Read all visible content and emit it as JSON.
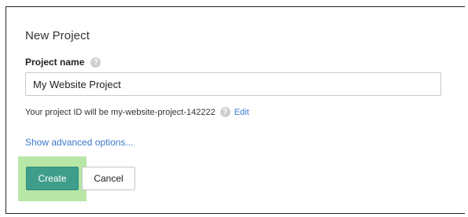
{
  "dialog": {
    "title": "New Project",
    "project_name": {
      "label": "Project name",
      "help_icon": "help-icon",
      "value": "My Website Project"
    },
    "project_id": {
      "text": "Your project ID will be my-website-project-142222",
      "help_icon": "help-icon",
      "edit_label": "Edit"
    },
    "advanced_link": "Show advanced options...",
    "buttons": {
      "create_label": "Create",
      "cancel_label": "Cancel"
    }
  },
  "colors": {
    "primary_button": "#3f9e8b",
    "highlight": "#b7e6a6",
    "link": "#3b78c9"
  }
}
